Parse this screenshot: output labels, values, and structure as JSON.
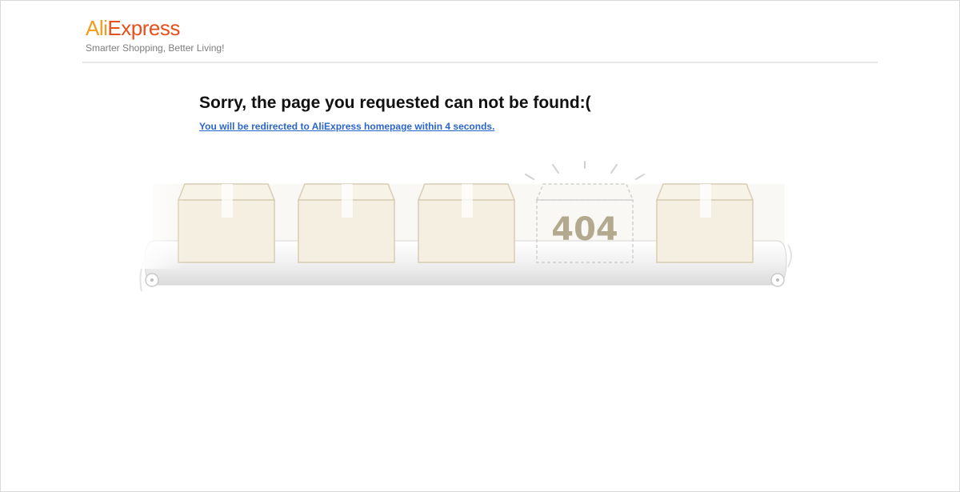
{
  "header": {
    "logo": {
      "part1": "Ali",
      "part2": "Express"
    },
    "tagline": "Smarter Shopping, Better Living!"
  },
  "main": {
    "title": "Sorry, the page you requested can not be found:(",
    "redirect_link": "You will be redirected to AliExpress homepage within 4 seconds."
  },
  "illustration": {
    "missing_box_label": "404",
    "box_count": 4
  },
  "colors": {
    "logo_ali": "#f49b1a",
    "logo_express": "#e8501b",
    "link": "#2a66c8",
    "box_fill": "#f5efe1",
    "box_stroke": "#d8cdb4"
  }
}
